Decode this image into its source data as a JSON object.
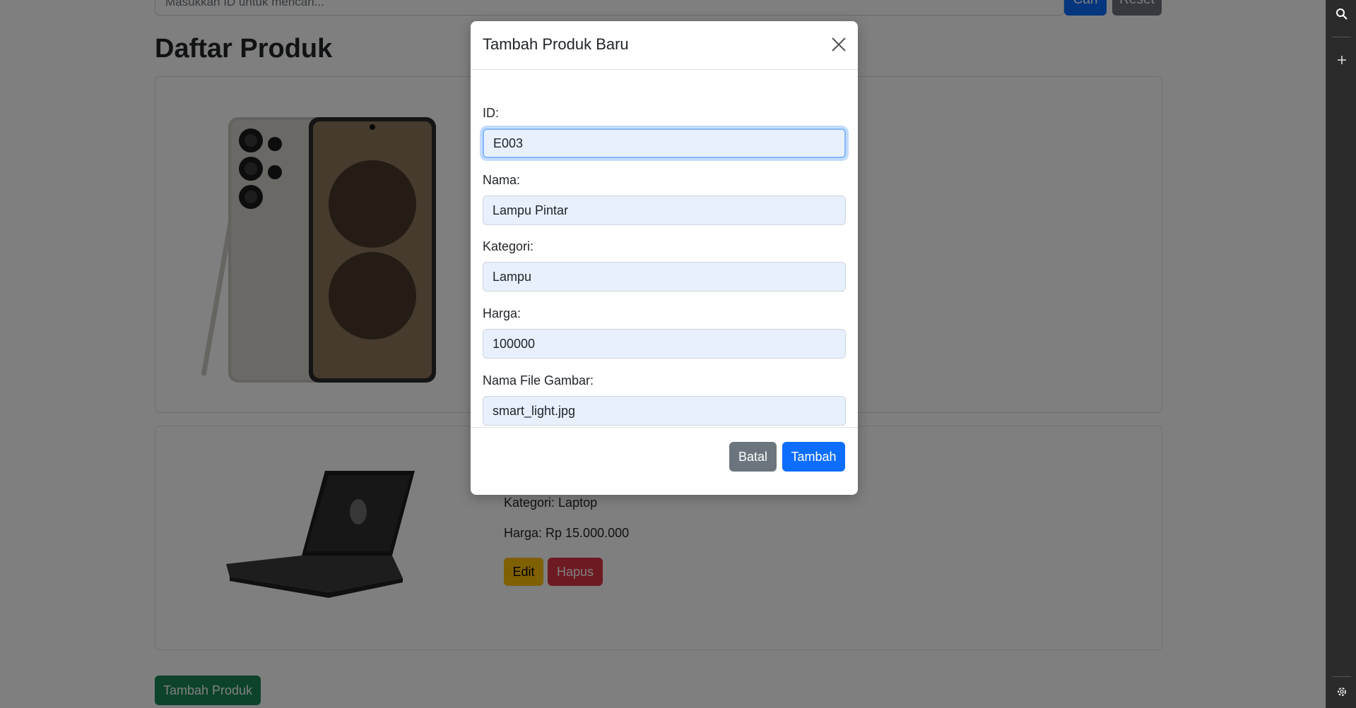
{
  "search": {
    "placeholder": "Masukkan ID untuk mencari...",
    "cari_label": "Cari",
    "reset_label": "Reset"
  },
  "page": {
    "title": "Daftar Produk",
    "add_button": "Tambah Produk"
  },
  "products": [
    {
      "image": "smartphone-image"
    },
    {
      "image": "laptop-image",
      "kategori": "Kategori: Laptop",
      "harga": "Harga: Rp 15.000.000",
      "edit_label": "Edit",
      "hapus_label": "Hapus"
    }
  ],
  "modal": {
    "title": "Tambah Produk Baru",
    "fields": [
      {
        "label": "ID:",
        "value": "E003"
      },
      {
        "label": "Nama:",
        "value": "Lampu Pintar"
      },
      {
        "label": "Kategori:",
        "value": "Lampu"
      },
      {
        "label": "Harga:",
        "value": "100000"
      },
      {
        "label": "Nama File Gambar:",
        "value": "smart_light.jpg"
      }
    ],
    "batal_label": "Batal",
    "tambah_label": "Tambah"
  },
  "colors": {
    "primary": "#0d6efd",
    "secondary": "#6c757d",
    "success": "#198754",
    "warning": "#ffc107",
    "danger": "#dc3545",
    "input_autofill": "#e8f0fe"
  },
  "sidebar_icons": [
    "search-icon",
    "plus-icon",
    "gear-icon"
  ]
}
